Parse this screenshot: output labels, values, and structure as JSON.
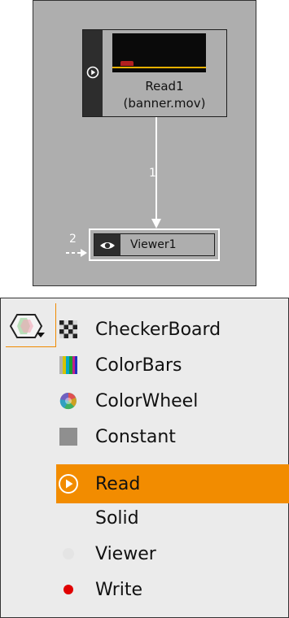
{
  "node_graph": {
    "read_node": {
      "title": "Read1",
      "subtitle": "(banner.mov)"
    },
    "viewer_node": {
      "title": "Viewer1"
    },
    "edge_label": "1",
    "viewer_input_label": "2"
  },
  "menu": {
    "items": [
      {
        "label": "CheckerBoard",
        "icon": "checkerboard-icon"
      },
      {
        "label": "ColorBars",
        "icon": "colorbars-icon"
      },
      {
        "label": "ColorWheel",
        "icon": "colorwheel-icon"
      },
      {
        "label": "Constant",
        "icon": "constant-icon"
      },
      {
        "label": "Read",
        "icon": "read-icon",
        "selected": true
      },
      {
        "label": "Solid",
        "icon": ""
      },
      {
        "label": "Viewer",
        "icon": "viewer-icon"
      },
      {
        "label": "Write",
        "icon": "write-icon"
      }
    ]
  },
  "colors": {
    "accent": "#f28c00",
    "graph_bg": "#aeaeae",
    "menu_bg": "#ebebeb"
  }
}
